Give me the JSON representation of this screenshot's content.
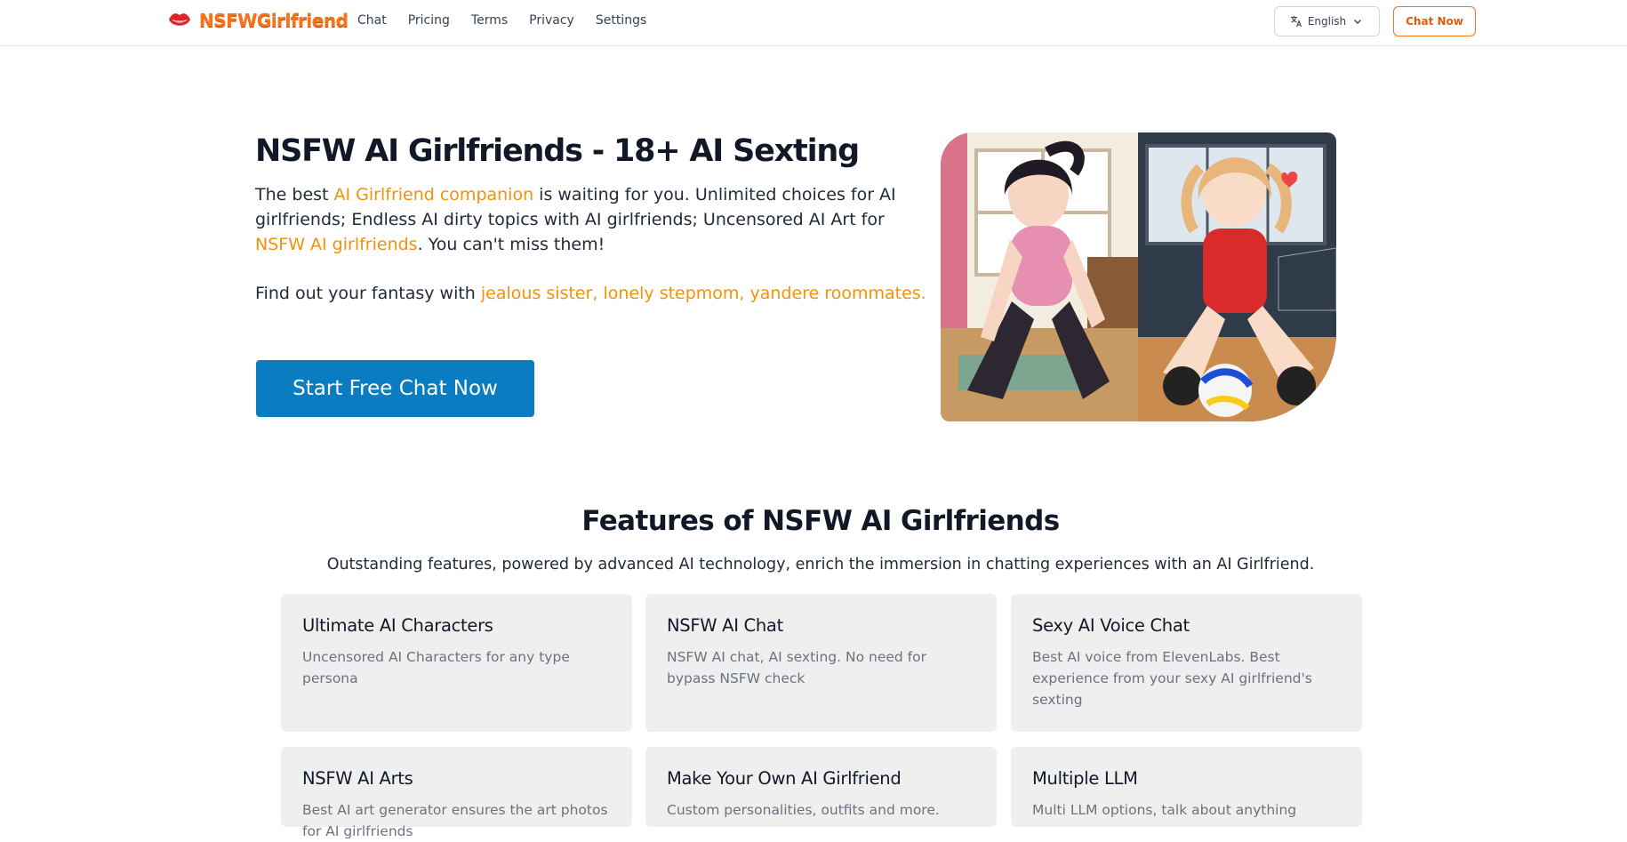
{
  "brand": {
    "name": "NSFWGirlfriend",
    "color": "#f97316"
  },
  "nav": [
    {
      "label": "Chat"
    },
    {
      "label": "Pricing"
    },
    {
      "label": "Terms"
    },
    {
      "label": "Privacy"
    },
    {
      "label": "Settings"
    }
  ],
  "language": {
    "selected": "English",
    "icon": "translate-icon"
  },
  "header_cta": "Chat Now",
  "hero": {
    "title": "NSFW AI Girlfriends - 18+ AI Sexting",
    "p1_a": "The best ",
    "p1_link1": "AI Girlfriend companion",
    "p1_b": " is waiting for you. Unlimited choices for AI girlfriends; Endless AI dirty topics with AI girlfriends; Uncensored AI Art for ",
    "p1_link2": "NSFW AI girlfriends",
    "p1_c": ". You can't miss them!",
    "p2_a": "Find out your fantasy with ",
    "p2_link": "jealous sister, lonely stepmom, yandere roommates.",
    "cta": "Start Free Chat Now",
    "cta_color": "#0a7cc1"
  },
  "features": {
    "title": "Features of NSFW AI Girlfriends",
    "subtitle": "Outstanding features, powered by advanced AI technology, enrich the immersion in chatting experiences with an AI Girlfriend.",
    "items": [
      {
        "title": "Ultimate AI Characters",
        "desc": "Uncensored AI Characters for any type persona"
      },
      {
        "title": "NSFW AI Chat",
        "desc": "NSFW AI chat, AI sexting. No need for bypass NSFW check"
      },
      {
        "title": "Sexy AI Voice Chat",
        "desc": "Best AI voice from ElevenLabs. Best experience from your sexy AI girlfriend's sexting"
      },
      {
        "title": "NSFW AI Arts",
        "desc": "Best AI art generator ensures the art photos for AI girlfriends"
      },
      {
        "title": "Make Your Own AI Girlfriend",
        "desc": "Custom personalities, outfits and more."
      },
      {
        "title": "Multiple LLM",
        "desc": "Multi LLM options, talk about anything"
      }
    ]
  }
}
